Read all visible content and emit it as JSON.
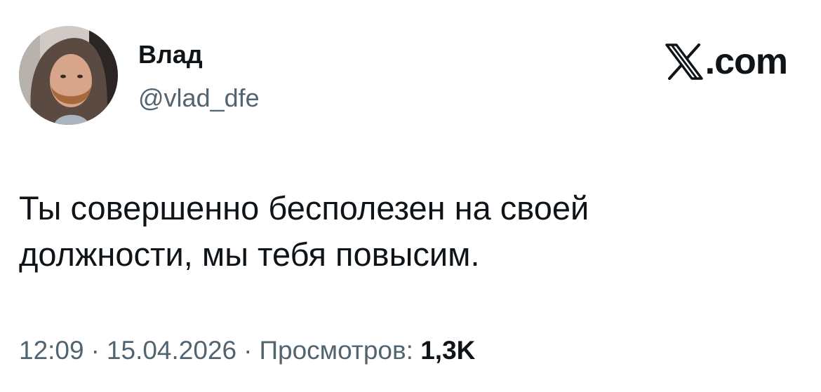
{
  "author": {
    "display_name": "Влад",
    "handle": "@vlad_dfe",
    "avatar_icon": "profile-photo-hooded-man"
  },
  "brand": {
    "logo_icon": "x-logo-icon",
    "text": ".com"
  },
  "tweet": {
    "lines": [
      "Ты совершенно бесполезен на своей",
      "должности, мы тебя повысим."
    ]
  },
  "meta": {
    "time": "12:09",
    "separator": "·",
    "date": "15.04.2026",
    "views_label": "Просмотров:",
    "views_count": "1,3K"
  },
  "colors": {
    "text_primary": "#0f1419",
    "text_secondary": "#536471",
    "background": "#ffffff"
  }
}
